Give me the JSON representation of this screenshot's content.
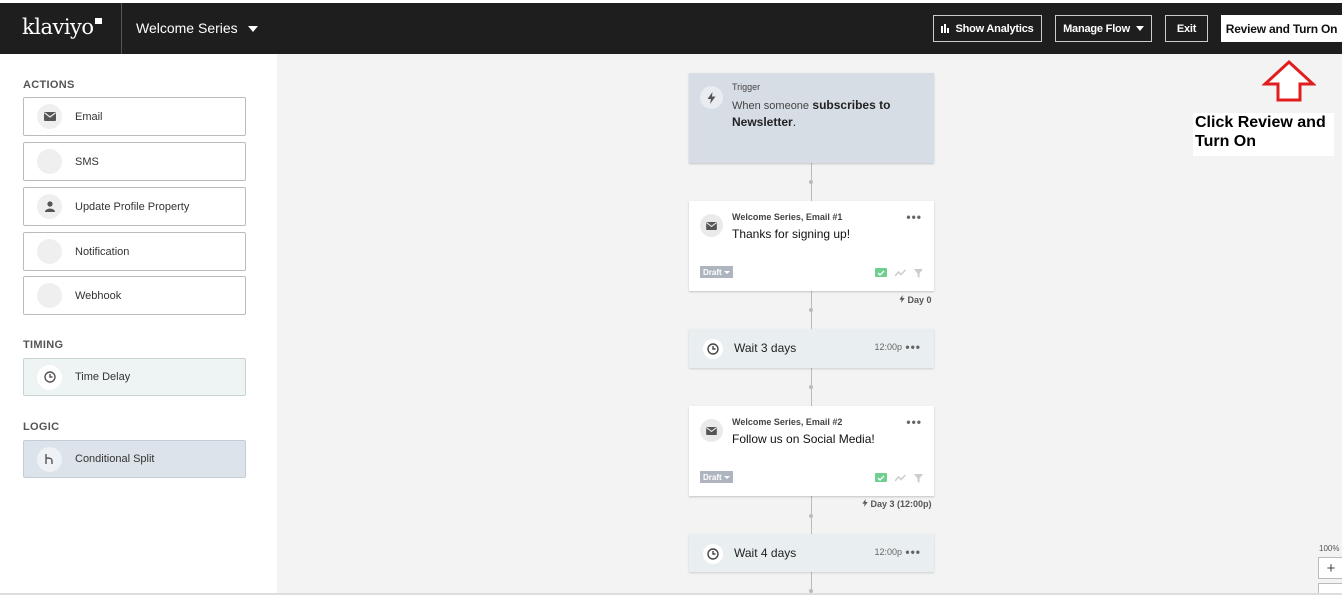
{
  "header": {
    "logo": "klaviyo",
    "flow_name": "Welcome Series",
    "show_analytics": "Show Analytics",
    "manage_flow": "Manage Flow",
    "exit": "Exit",
    "review": "Review and Turn On"
  },
  "sidebar": {
    "actions_title": "ACTIONS",
    "actions": [
      {
        "label": "Email",
        "icon": "envelope-icon"
      },
      {
        "label": "SMS",
        "icon": ""
      },
      {
        "label": "Update Profile Property",
        "icon": "person-icon"
      },
      {
        "label": "Notification",
        "icon": ""
      },
      {
        "label": "Webhook",
        "icon": ""
      }
    ],
    "timing_title": "TIMING",
    "timing": {
      "label": "Time Delay",
      "icon": "clock-icon"
    },
    "logic_title": "LOGIC",
    "logic": {
      "label": "Conditional Split",
      "icon": "split-icon"
    }
  },
  "flow": {
    "trigger": {
      "label": "Trigger",
      "text_prefix": "When someone",
      "text_bold1": "subscribes to",
      "text_bold2": "Newsletter",
      "text_suffix": "."
    },
    "email1": {
      "title": "Welcome Series, Email #1",
      "subject": "Thanks for signing up!",
      "status": "Draft",
      "day": "Day 0"
    },
    "wait1": {
      "text": "Wait 3 days",
      "time": "12:00p"
    },
    "email2": {
      "title": "Welcome Series, Email #2",
      "subject": "Follow us on Social Media!",
      "status": "Draft",
      "day": "Day 3 (12:00p)"
    },
    "wait2": {
      "text": "Wait 4 days",
      "time": "12:00p"
    }
  },
  "annotation": {
    "line1": "Click Review and",
    "line2": "Turn On",
    "arrow_color": "#e11d1d"
  },
  "zoom": {
    "level": "100%",
    "plus": "+"
  }
}
